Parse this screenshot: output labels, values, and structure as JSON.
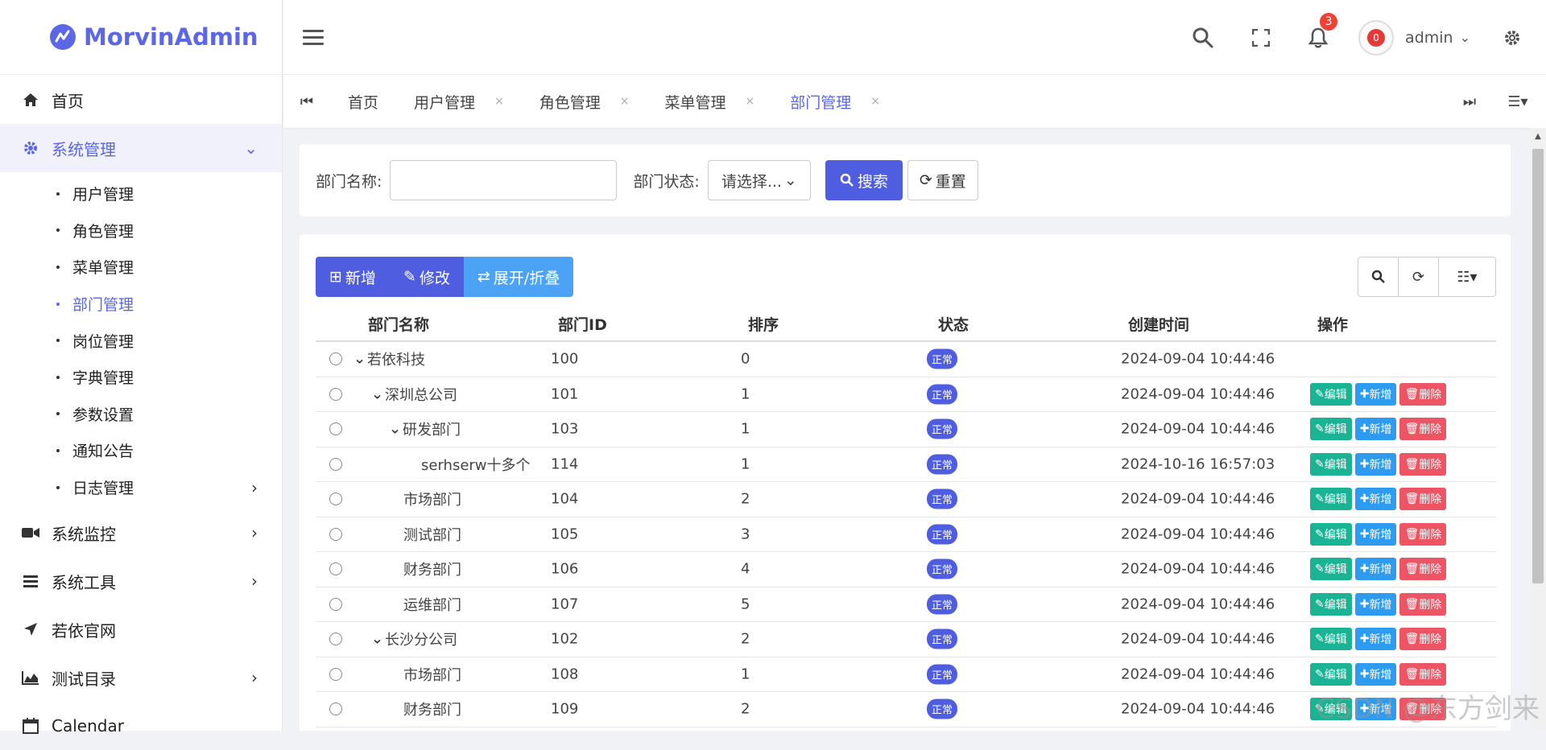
{
  "app": {
    "name": "MorvinAdmin",
    "brand_color": "#5b67e6"
  },
  "sidebar": {
    "items": [
      {
        "label": "首页",
        "icon": "home-icon"
      },
      {
        "label": "系统管理",
        "icon": "gear-icon",
        "expanded": true,
        "children": [
          {
            "label": "用户管理"
          },
          {
            "label": "角色管理"
          },
          {
            "label": "菜单管理"
          },
          {
            "label": "部门管理",
            "active": true
          },
          {
            "label": "岗位管理"
          },
          {
            "label": "字典管理"
          },
          {
            "label": "参数设置"
          },
          {
            "label": "通知公告"
          },
          {
            "label": "日志管理",
            "has_children": true
          }
        ]
      },
      {
        "label": "系统监控",
        "icon": "video-icon"
      },
      {
        "label": "系统工具",
        "icon": "bars-icon"
      },
      {
        "label": "若依官网",
        "icon": "location-arrow-icon"
      },
      {
        "label": "测试目录",
        "icon": "area-chart-icon"
      },
      {
        "label": "Calendar",
        "icon": "calendar-icon"
      }
    ]
  },
  "header": {
    "username": "admin",
    "notification_count": "3",
    "avatar_text": "0"
  },
  "tabs": [
    {
      "label": "首页",
      "closable": false
    },
    {
      "label": "用户管理",
      "closable": true
    },
    {
      "label": "角色管理",
      "closable": true
    },
    {
      "label": "菜单管理",
      "closable": true
    },
    {
      "label": "部门管理",
      "closable": true,
      "active": true
    }
  ],
  "search": {
    "dept_name_label": "部门名称:",
    "dept_name_value": "",
    "status_label": "部门状态:",
    "status_value": "请选择...",
    "search_button": "搜索",
    "reset_button": "重置"
  },
  "toolbar": {
    "add": "新增",
    "edit": "修改",
    "expand": "展开/折叠"
  },
  "table": {
    "headers": [
      "部门名称",
      "部门ID",
      "排序",
      "状态",
      "创建时间",
      "操作"
    ],
    "op_labels": {
      "edit": "编辑",
      "add": "新增",
      "del": "删除"
    },
    "rows": [
      {
        "name": "若依科技",
        "id": "100",
        "order": "0",
        "status": "正常",
        "created": "2024-09-04 10:44:46",
        "level": 0,
        "toggle": true,
        "ops": false
      },
      {
        "name": "深圳总公司",
        "id": "101",
        "order": "1",
        "status": "正常",
        "created": "2024-09-04 10:44:46",
        "level": 1,
        "toggle": true,
        "ops": true
      },
      {
        "name": "研发部门",
        "id": "103",
        "order": "1",
        "status": "正常",
        "created": "2024-09-04 10:44:46",
        "level": 2,
        "toggle": true,
        "ops": true
      },
      {
        "name": "serhserw十多个",
        "id": "114",
        "order": "1",
        "status": "正常",
        "created": "2024-10-16 16:57:03",
        "level": 3,
        "toggle": false,
        "ops": true
      },
      {
        "name": "市场部门",
        "id": "104",
        "order": "2",
        "status": "正常",
        "created": "2024-09-04 10:44:46",
        "level": 2,
        "toggle": false,
        "ops": true
      },
      {
        "name": "测试部门",
        "id": "105",
        "order": "3",
        "status": "正常",
        "created": "2024-09-04 10:44:46",
        "level": 2,
        "toggle": false,
        "ops": true
      },
      {
        "name": "财务部门",
        "id": "106",
        "order": "4",
        "status": "正常",
        "created": "2024-09-04 10:44:46",
        "level": 2,
        "toggle": false,
        "ops": true
      },
      {
        "name": "运维部门",
        "id": "107",
        "order": "5",
        "status": "正常",
        "created": "2024-09-04 10:44:46",
        "level": 2,
        "toggle": false,
        "ops": true
      },
      {
        "name": "长沙分公司",
        "id": "102",
        "order": "2",
        "status": "正常",
        "created": "2024-09-04 10:44:46",
        "level": 1,
        "toggle": true,
        "ops": true
      },
      {
        "name": "市场部门",
        "id": "108",
        "order": "1",
        "status": "正常",
        "created": "2024-09-04 10:44:46",
        "level": 2,
        "toggle": false,
        "ops": true
      },
      {
        "name": "财务部门",
        "id": "109",
        "order": "2",
        "status": "正常",
        "created": "2024-09-04 10:44:46",
        "level": 2,
        "toggle": false,
        "ops": true
      }
    ]
  },
  "watermark": "CSDN @东方剑来"
}
